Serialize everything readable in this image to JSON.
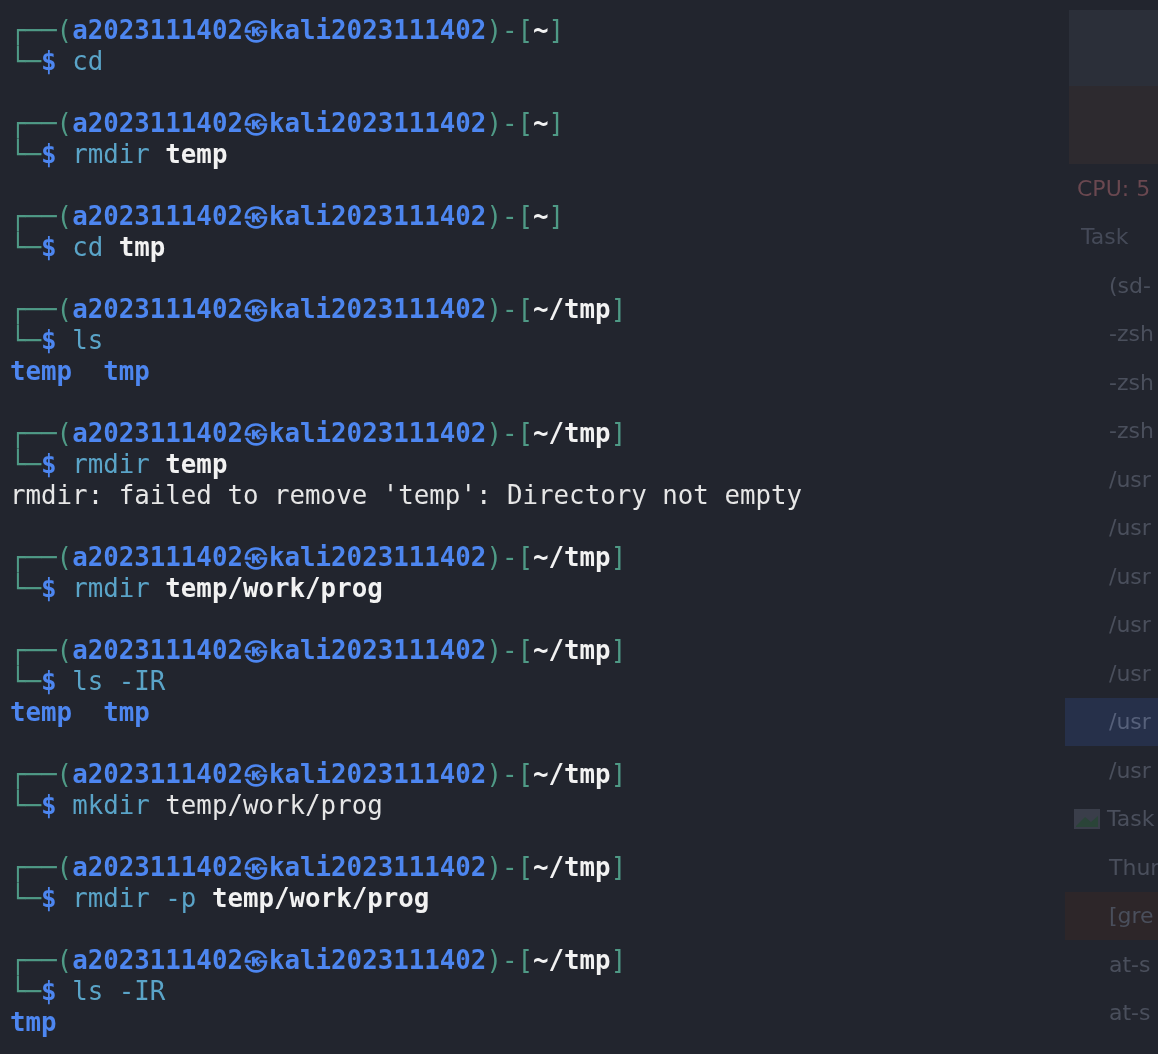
{
  "terminal": {
    "blocks": [
      {
        "prompt": {
          "open": "┌──(",
          "user": "a2023111402",
          "at": "㉿",
          "host": "kali2023111402",
          "mid": ")-[",
          "path": "~",
          "close": "]"
        },
        "corner": "└─",
        "sign": "$",
        "command": [
          {
            "text": "cd",
            "kind": "command"
          }
        ]
      },
      {
        "prompt": {
          "open": "┌──(",
          "user": "a2023111402",
          "at": "㉿",
          "host": "kali2023111402",
          "mid": ")-[",
          "path": "~",
          "close": "]"
        },
        "corner": "└─",
        "sign": "$",
        "command": [
          {
            "text": "rmdir",
            "kind": "command"
          },
          {
            "text": "temp",
            "kind": "path"
          }
        ]
      },
      {
        "prompt": {
          "open": "┌──(",
          "user": "a2023111402",
          "at": "㉿",
          "host": "kali2023111402",
          "mid": ")-[",
          "path": "~",
          "close": "]"
        },
        "corner": "└─",
        "sign": "$",
        "command": [
          {
            "text": "cd",
            "kind": "command"
          },
          {
            "text": "tmp",
            "kind": "path"
          }
        ]
      },
      {
        "prompt": {
          "open": "┌──(",
          "user": "a2023111402",
          "at": "㉿",
          "host": "kali2023111402",
          "mid": ")-[",
          "path": "~/tmp",
          "close": "]"
        },
        "corner": "└─",
        "sign": "$",
        "command": [
          {
            "text": "ls",
            "kind": "command"
          }
        ],
        "output": [
          {
            "kind": "listing",
            "items": [
              "temp",
              "tmp"
            ]
          }
        ]
      },
      {
        "prompt": {
          "open": "┌──(",
          "user": "a2023111402",
          "at": "㉿",
          "host": "kali2023111402",
          "mid": ")-[",
          "path": "~/tmp",
          "close": "]"
        },
        "corner": "└─",
        "sign": "$",
        "command": [
          {
            "text": "rmdir",
            "kind": "command"
          },
          {
            "text": "temp",
            "kind": "path"
          }
        ],
        "output": [
          {
            "kind": "text",
            "text": "rmdir: failed to remove 'temp': Directory not empty"
          }
        ]
      },
      {
        "prompt": {
          "open": "┌──(",
          "user": "a2023111402",
          "at": "㉿",
          "host": "kali2023111402",
          "mid": ")-[",
          "path": "~/tmp",
          "close": "]"
        },
        "corner": "└─",
        "sign": "$",
        "command": [
          {
            "text": "rmdir",
            "kind": "command"
          },
          {
            "text": "temp/work/prog",
            "kind": "path"
          }
        ]
      },
      {
        "prompt": {
          "open": "┌──(",
          "user": "a2023111402",
          "at": "㉿",
          "host": "kali2023111402",
          "mid": ")-[",
          "path": "~/tmp",
          "close": "]"
        },
        "corner": "└─",
        "sign": "$",
        "command": [
          {
            "text": "ls",
            "kind": "command"
          },
          {
            "text": "-IR",
            "kind": "option"
          }
        ],
        "output": [
          {
            "kind": "listing",
            "items": [
              "temp",
              "tmp"
            ]
          }
        ]
      },
      {
        "prompt": {
          "open": "┌──(",
          "user": "a2023111402",
          "at": "㉿",
          "host": "kali2023111402",
          "mid": ")-[",
          "path": "~/tmp",
          "close": "]"
        },
        "corner": "└─",
        "sign": "$",
        "command": [
          {
            "text": "mkdir",
            "kind": "command"
          },
          {
            "text": "temp/work/prog",
            "kind": "argument"
          }
        ]
      },
      {
        "prompt": {
          "open": "┌──(",
          "user": "a2023111402",
          "at": "㉿",
          "host": "kali2023111402",
          "mid": ")-[",
          "path": "~/tmp",
          "close": "]"
        },
        "corner": "└─",
        "sign": "$",
        "command": [
          {
            "text": "rmdir",
            "kind": "command"
          },
          {
            "text": "-p",
            "kind": "option"
          },
          {
            "text": "temp/work/prog",
            "kind": "path"
          }
        ]
      },
      {
        "prompt": {
          "open": "┌──(",
          "user": "a2023111402",
          "at": "㉿",
          "host": "kali2023111402",
          "mid": ")-[",
          "path": "~/tmp",
          "close": "]"
        },
        "corner": "└─",
        "sign": "$",
        "command": [
          {
            "text": "ls",
            "kind": "command"
          },
          {
            "text": "-IR",
            "kind": "option"
          }
        ],
        "output": [
          {
            "kind": "listing",
            "items": [
              "tmp"
            ]
          }
        ]
      }
    ]
  },
  "background_window": {
    "rows": [
      {
        "text": "CPU: 5",
        "kind": "header",
        "selected": false
      },
      {
        "text": "Task",
        "kind": "title",
        "selected": false
      },
      {
        "text": "(sd-",
        "kind": "item",
        "selected": false
      },
      {
        "text": "-zsh",
        "kind": "item",
        "selected": false
      },
      {
        "text": "-zsh",
        "kind": "item",
        "selected": false
      },
      {
        "text": "-zsh",
        "kind": "item",
        "selected": false
      },
      {
        "text": "/usr",
        "kind": "item",
        "selected": false
      },
      {
        "text": "/usr",
        "kind": "item",
        "selected": false
      },
      {
        "text": "/usr",
        "kind": "item",
        "selected": false
      },
      {
        "text": "/usr",
        "kind": "item",
        "selected": false
      },
      {
        "text": "/usr",
        "kind": "item",
        "selected": false
      },
      {
        "text": "/usr",
        "kind": "item",
        "selected": true
      },
      {
        "text": "/usr",
        "kind": "item",
        "selected": false
      },
      {
        "text": "Task",
        "kind": "group",
        "selected": false
      },
      {
        "text": "Thur",
        "kind": "item",
        "selected": false
      },
      {
        "text": "[gre",
        "kind": "alert",
        "selected": false
      },
      {
        "text": "at-s",
        "kind": "item",
        "selected": false
      },
      {
        "text": "at-s",
        "kind": "item",
        "selected": false
      }
    ]
  }
}
